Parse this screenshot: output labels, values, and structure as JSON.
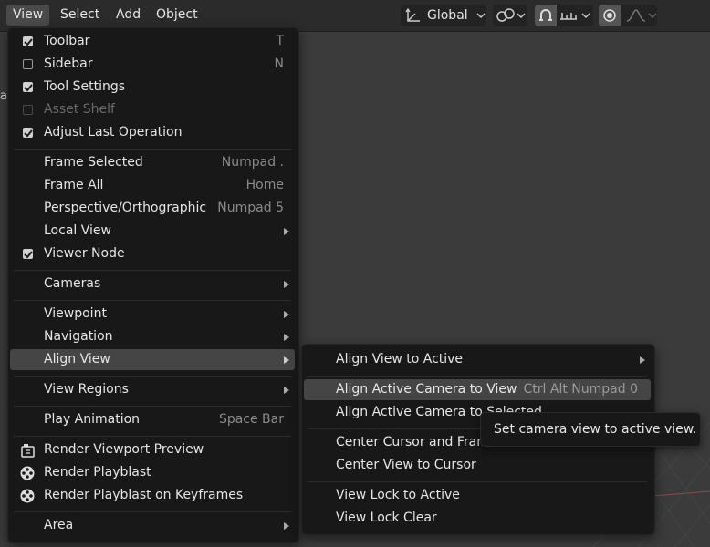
{
  "topbar": {
    "menus": [
      "View",
      "Select",
      "Add",
      "Object"
    ],
    "transform_orientation": "Global"
  },
  "edge_text": "a",
  "view_menu": {
    "toggles": [
      {
        "label": "Toolbar",
        "shortcut": "T",
        "state": "on"
      },
      {
        "label": "Sidebar",
        "shortcut": "N",
        "state": "off"
      },
      {
        "label": "Tool Settings",
        "shortcut": "",
        "state": "on"
      },
      {
        "label": "Asset Shelf",
        "shortcut": "",
        "state": "disabled"
      },
      {
        "label": "Adjust Last Operation",
        "shortcut": "",
        "state": "on"
      }
    ],
    "frame": [
      {
        "label": "Frame Selected",
        "shortcut": "Numpad ."
      },
      {
        "label": "Frame All",
        "shortcut": "Home"
      },
      {
        "label": "Perspective/Orthographic",
        "shortcut": "Numpad 5"
      },
      {
        "label": "Local View",
        "shortcut": ""
      },
      {
        "label": "Viewer Node",
        "shortcut": ""
      }
    ],
    "cameras": "Cameras",
    "viewpoint": "Viewpoint",
    "navigation": "Navigation",
    "align_view": "Align View",
    "view_regions": "View Regions",
    "play_animation": {
      "label": "Play Animation",
      "shortcut": "Space Bar"
    },
    "render": [
      {
        "label": "Render Viewport Preview"
      },
      {
        "label": "Render Playblast"
      },
      {
        "label": "Render Playblast on Keyframes"
      }
    ],
    "area": "Area"
  },
  "align_submenu": {
    "align_to_active": "Align View to Active",
    "camera_to_view": {
      "label": "Align Active Camera to View",
      "shortcut": "Ctrl Alt Numpad 0"
    },
    "camera_to_selected": "Align Active Camera to Selected",
    "center_cursor_frame": "Center Cursor and Frame All",
    "center_view_cursor": "Center View to Cursor",
    "lock_to_active": "View Lock to Active",
    "lock_clear": "View Lock Clear"
  },
  "tooltip": "Set camera view to active view.",
  "colors": {
    "menu_bg": "#181818",
    "highlight": "#454545",
    "shortcut_text": "#8a8a8a",
    "viewport_bg": "#3b3b3b"
  }
}
